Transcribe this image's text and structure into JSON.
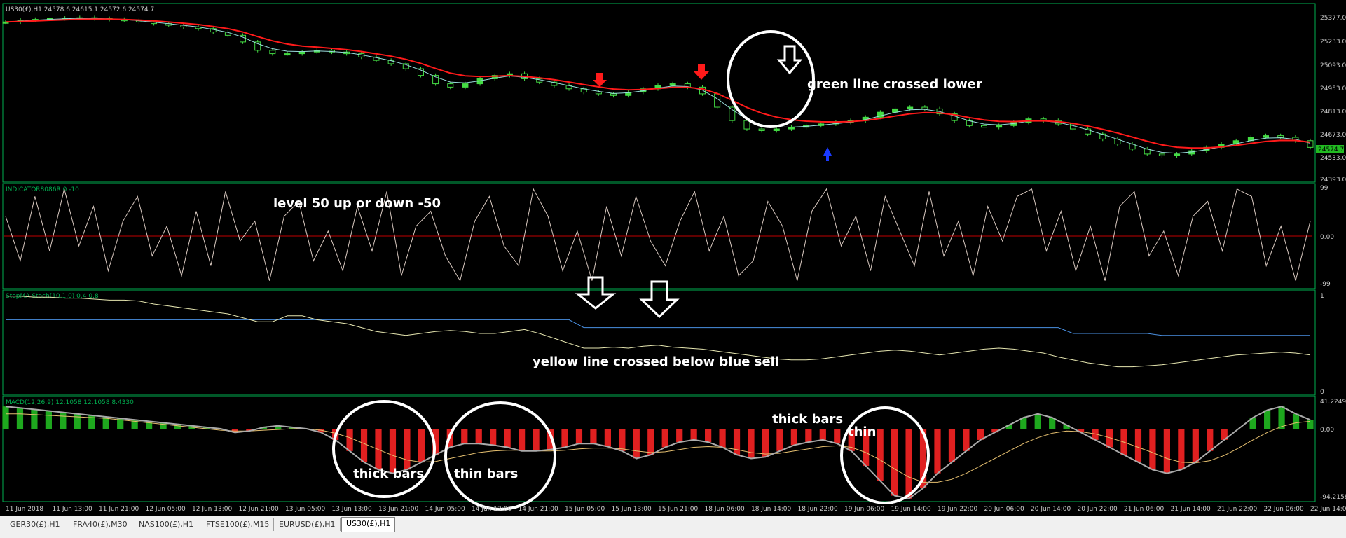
{
  "colors": {
    "bg": "#000000",
    "border": "#00b050",
    "candle_up": "#44dd44",
    "ma_red": "#ff1a1a",
    "ma_thin": "#99dddd",
    "osc": "#d9c9c0",
    "mid": "#c00000",
    "yellow": "#e6e6b0",
    "blue": "#4a90e2",
    "hist_green": "#1ea81e",
    "hist_red": "#e02020",
    "signal": "#e6c070",
    "macd": "#aaaaaa"
  },
  "main": {
    "header": "US30(£),H1  24578.6 24615.1 24572.6 24574.7",
    "price_ticks": [
      "25377.0",
      "25233.0",
      "25093.0",
      "24953.0",
      "24813.0",
      "24673.0",
      "24533.0",
      "24393.0"
    ],
    "last_price": "24574.7",
    "annotation": "green line crossed lower",
    "arrows": [
      {
        "icon": "arrow-down-icon",
        "color": "red"
      },
      {
        "icon": "arrow-down-icon",
        "color": "red"
      },
      {
        "icon": "arrow-up-icon",
        "color": "blue"
      }
    ],
    "price_path": [
      25330,
      25340,
      25345,
      25350,
      25352,
      25355,
      25350,
      25345,
      25340,
      25330,
      25320,
      25310,
      25300,
      25290,
      25270,
      25250,
      25210,
      25160,
      25140,
      25140,
      25150,
      25160,
      25150,
      25140,
      25120,
      25100,
      25080,
      25050,
      25010,
      24960,
      24940,
      24960,
      24990,
      25010,
      25020,
      24990,
      24970,
      24950,
      24930,
      24910,
      24900,
      24890,
      24910,
      24930,
      24950,
      24960,
      24940,
      24900,
      24820,
      24740,
      24690,
      24680,
      24690,
      24700,
      24710,
      24720,
      24730,
      24740,
      24760,
      24790,
      24810,
      24820,
      24810,
      24780,
      24740,
      24710,
      24700,
      24710,
      24730,
      24750,
      24740,
      24720,
      24690,
      24660,
      24630,
      24600,
      24570,
      24540,
      24530,
      24540,
      24560,
      24580,
      24600,
      24620,
      24640,
      24650,
      24640,
      24620,
      24580
    ]
  },
  "osc": {
    "header": "INDICATOR8086R 0 -10",
    "ticks": [
      "99",
      "0.00",
      "-99"
    ],
    "annotation": "level 50 up or down  -50",
    "values": [
      40,
      -50,
      80,
      -30,
      95,
      -20,
      60,
      -70,
      30,
      80,
      -40,
      20,
      -80,
      50,
      -60,
      90,
      -10,
      30,
      -90,
      40,
      70,
      -50,
      10,
      -70,
      60,
      -30,
      90,
      -80,
      20,
      50,
      -40,
      -90,
      30,
      80,
      -20,
      -60,
      95,
      40,
      -70,
      10,
      -90,
      60,
      -40,
      80,
      -10,
      -60,
      30,
      90,
      -30,
      40,
      -80,
      -50,
      70,
      20,
      -90,
      50,
      95,
      -20,
      40,
      -70,
      80,
      10,
      -60,
      90,
      -40,
      30,
      -80,
      60,
      -10,
      80,
      95,
      -30,
      50,
      -70,
      20,
      -90,
      60,
      90,
      -40,
      10,
      -80,
      40,
      70,
      -30,
      95,
      80,
      -60,
      20,
      -90,
      30
    ]
  },
  "stoch": {
    "header": "StepMA Stoch(10,1,0) 0.4 0.8",
    "ticks": [
      "1",
      "0"
    ],
    "annotation": "yellow line crossed below blue sell",
    "yellow": [
      0.98,
      0.98,
      0.97,
      0.97,
      0.96,
      0.96,
      0.95,
      0.94,
      0.94,
      0.93,
      0.9,
      0.88,
      0.86,
      0.84,
      0.82,
      0.8,
      0.76,
      0.72,
      0.72,
      0.78,
      0.78,
      0.74,
      0.72,
      0.7,
      0.66,
      0.62,
      0.6,
      0.58,
      0.6,
      0.62,
      0.63,
      0.62,
      0.6,
      0.6,
      0.62,
      0.64,
      0.6,
      0.55,
      0.5,
      0.45,
      0.45,
      0.46,
      0.45,
      0.47,
      0.48,
      0.46,
      0.45,
      0.44,
      0.42,
      0.4,
      0.38,
      0.36,
      0.34,
      0.33,
      0.33,
      0.34,
      0.36,
      0.38,
      0.4,
      0.42,
      0.43,
      0.42,
      0.4,
      0.38,
      0.4,
      0.42,
      0.44,
      0.45,
      0.44,
      0.42,
      0.4,
      0.36,
      0.33,
      0.3,
      0.28,
      0.26,
      0.26,
      0.27,
      0.28,
      0.3,
      0.32,
      0.34,
      0.36,
      0.38,
      0.39,
      0.4,
      0.41,
      0.4,
      0.38
    ],
    "blue": [
      0.74,
      0.74,
      0.74,
      0.74,
      0.74,
      0.74,
      0.74,
      0.74,
      0.74,
      0.74,
      0.74,
      0.74,
      0.74,
      0.74,
      0.74,
      0.74,
      0.74,
      0.74,
      0.74,
      0.74,
      0.74,
      0.74,
      0.74,
      0.74,
      0.74,
      0.74,
      0.74,
      0.74,
      0.74,
      0.74,
      0.74,
      0.74,
      0.74,
      0.74,
      0.74,
      0.74,
      0.74,
      0.74,
      0.74,
      0.66,
      0.66,
      0.66,
      0.66,
      0.66,
      0.66,
      0.66,
      0.66,
      0.66,
      0.66,
      0.66,
      0.66,
      0.66,
      0.66,
      0.66,
      0.66,
      0.66,
      0.66,
      0.66,
      0.66,
      0.66,
      0.66,
      0.66,
      0.66,
      0.66,
      0.66,
      0.66,
      0.66,
      0.66,
      0.66,
      0.66,
      0.66,
      0.66,
      0.6,
      0.6,
      0.6,
      0.6,
      0.6,
      0.6,
      0.58,
      0.58,
      0.58,
      0.58,
      0.58,
      0.58,
      0.58,
      0.58,
      0.58,
      0.58,
      0.58
    ]
  },
  "macd": {
    "header": "MACD(12,26,9) 12.1058 12.1058 8.4330",
    "ticks": [
      "41.2249",
      "0.00",
      "-94.2158"
    ],
    "annotations": [
      {
        "text": "thick bars"
      },
      {
        "text": "thin bars"
      },
      {
        "text": "thick bars"
      },
      {
        "text": "thin"
      }
    ],
    "hist": [
      30,
      28,
      26,
      24,
      22,
      20,
      18,
      16,
      14,
      12,
      10,
      8,
      6,
      4,
      2,
      0,
      -5,
      -3,
      2,
      4,
      2,
      0,
      -5,
      -15,
      -30,
      -45,
      -55,
      -60,
      -55,
      -45,
      -35,
      -25,
      -20,
      -20,
      -22,
      -25,
      -30,
      -30,
      -28,
      -25,
      -20,
      -20,
      -24,
      -30,
      -40,
      -35,
      -25,
      -18,
      -15,
      -18,
      -25,
      -35,
      -40,
      -38,
      -30,
      -22,
      -18,
      -15,
      -20,
      -30,
      -50,
      -70,
      -90,
      -94,
      -80,
      -60,
      -45,
      -30,
      -15,
      -5,
      5,
      15,
      20,
      15,
      5,
      -5,
      -15,
      -25,
      -35,
      -45,
      -55,
      -60,
      -55,
      -45,
      -30,
      -15,
      0,
      15,
      25,
      30,
      20,
      12
    ],
    "signal": [
      20,
      20,
      19,
      18,
      17,
      16,
      15,
      14,
      12,
      10,
      8,
      6,
      4,
      2,
      0,
      -2,
      -3,
      -3,
      -2,
      -1,
      0,
      0,
      -2,
      -6,
      -12,
      -20,
      -28,
      -36,
      -42,
      -45,
      -44,
      -40,
      -36,
      -32,
      -30,
      -29,
      -29,
      -30,
      -30,
      -29,
      -27,
      -26,
      -26,
      -27,
      -30,
      -32,
      -31,
      -28,
      -25,
      -24,
      -25,
      -28,
      -32,
      -34,
      -33,
      -30,
      -27,
      -24,
      -23,
      -25,
      -32,
      -42,
      -54,
      -65,
      -72,
      -72,
      -68,
      -60,
      -50,
      -40,
      -30,
      -20,
      -12,
      -6,
      -3,
      -4,
      -7,
      -12,
      -18,
      -25,
      -32,
      -40,
      -45,
      -46,
      -43,
      -36,
      -26,
      -15,
      -5,
      3,
      8,
      10
    ]
  },
  "time_axis": [
    "11 Jun 2018",
    "11 Jun 13:00",
    "11 Jun 21:00",
    "12 Jun 05:00",
    "12 Jun 13:00",
    "12 Jun 21:00",
    "13 Jun 05:00",
    "13 Jun 13:00",
    "13 Jun 21:00",
    "14 Jun 05:00",
    "14 Jun 13:00",
    "14 Jun 21:00",
    "15 Jun 05:00",
    "15 Jun 13:00",
    "15 Jun 21:00",
    "18 Jun 06:00",
    "18 Jun 14:00",
    "18 Jun 22:00",
    "19 Jun 06:00",
    "19 Jun 14:00",
    "19 Jun 22:00",
    "20 Jun 06:00",
    "20 Jun 14:00",
    "20 Jun 22:00",
    "21 Jun 06:00",
    "21 Jun 14:00",
    "21 Jun 22:00",
    "22 Jun 06:00",
    "22 Jun 14:00"
  ],
  "tabs": [
    {
      "label": "GER30(£),H1",
      "active": false
    },
    {
      "label": "FRA40(£),M30",
      "active": false
    },
    {
      "label": "NAS100(£),H1",
      "active": false
    },
    {
      "label": "FTSE100(£),M15",
      "active": false
    },
    {
      "label": "EURUSD(£),H1",
      "active": false
    },
    {
      "label": "US30(£),H1",
      "active": true
    }
  ]
}
